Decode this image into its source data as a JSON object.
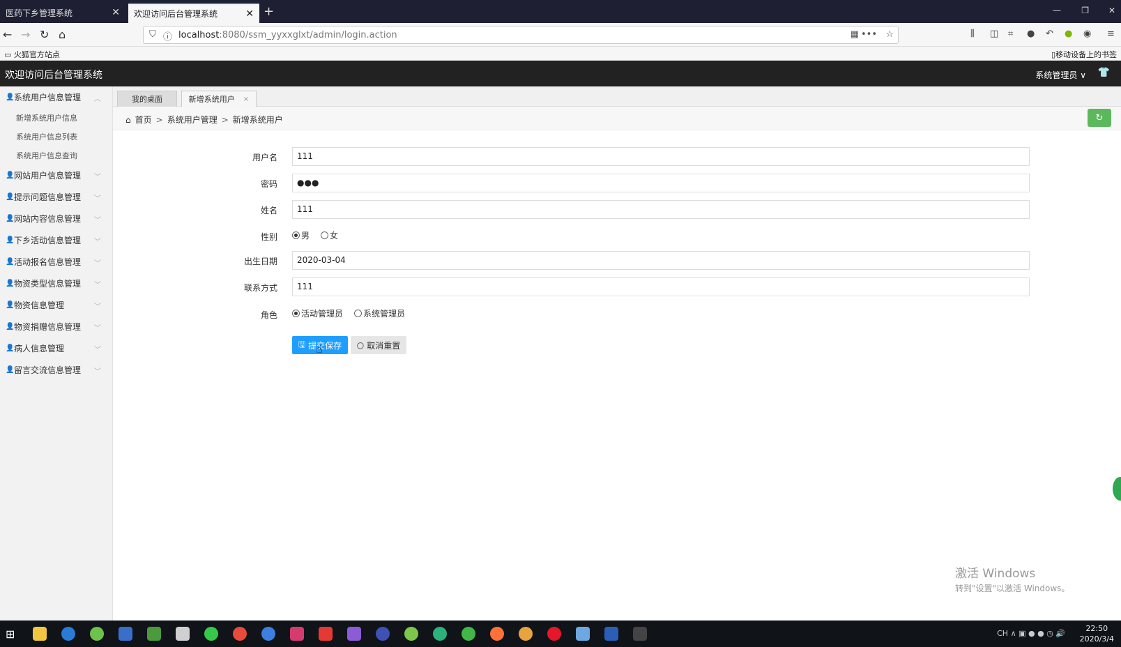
{
  "browser": {
    "tabs": [
      {
        "label": "医药下乡管理系统"
      },
      {
        "label": "欢迎访问后台管理系统"
      }
    ],
    "new_tab_label": "+",
    "url_host": "localhost",
    "url_rest": ":8080/ssm_yyxxglxt/admin/login.action",
    "bookmark_left": "火狐官方站点",
    "bookmark_right": "移动设备上的书签"
  },
  "header": {
    "title": "欢迎访问后台管理系统",
    "user": "系统管理员"
  },
  "sidebar": {
    "groups": [
      {
        "label": "系统用户信息管理",
        "expanded": true,
        "items": [
          "新增系统用户信息",
          "系统用户信息列表",
          "系统用户信息查询"
        ]
      },
      {
        "label": "网站用户信息管理"
      },
      {
        "label": "提示问题信息管理"
      },
      {
        "label": "网站内容信息管理"
      },
      {
        "label": "下乡活动信息管理"
      },
      {
        "label": "活动报名信息管理"
      },
      {
        "label": "物资类型信息管理"
      },
      {
        "label": "物资信息管理"
      },
      {
        "label": "物资捐赠信息管理"
      },
      {
        "label": "病人信息管理"
      },
      {
        "label": "留言交流信息管理"
      }
    ]
  },
  "content_tabs": [
    {
      "label": "我的桌面"
    },
    {
      "label": "新增系统用户",
      "close": "×"
    }
  ],
  "breadcrumb": {
    "home": "首页",
    "level1": "系统用户管理",
    "level2": "新增系统用户",
    "sep": ">"
  },
  "form": {
    "username": {
      "label": "用户名",
      "value": "111"
    },
    "password": {
      "label": "密码",
      "value": "●●●"
    },
    "name": {
      "label": "姓名",
      "value": "111"
    },
    "gender": {
      "label": "性别",
      "options": [
        "男",
        "女"
      ],
      "selected": "男"
    },
    "birthday": {
      "label": "出生日期",
      "value": "2020-03-04"
    },
    "contact": {
      "label": "联系方式",
      "value": "111"
    },
    "role": {
      "label": "角色",
      "options": [
        "活动管理员",
        "系统管理员"
      ],
      "selected": "活动管理员"
    },
    "save_label": "提交保存",
    "reset_label": "取消重置"
  },
  "watermark": {
    "line1": "激活 Windows",
    "line2": "转到\"设置\"以激活 Windows。"
  },
  "taskbar": {
    "tray_lang": "CH",
    "clock_time": "22:50",
    "clock_date": "2020/3/4"
  },
  "colors": {
    "primary": "#1e9fff",
    "refresh": "#5cb85c",
    "header": "#222222"
  }
}
